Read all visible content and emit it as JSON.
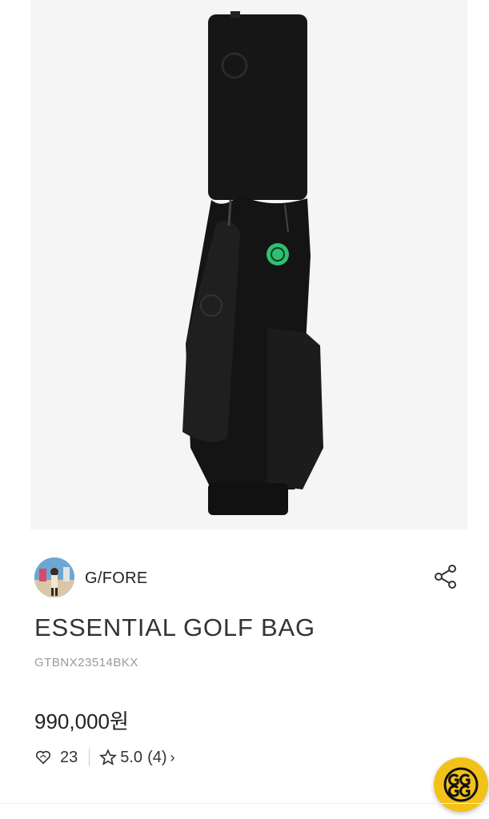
{
  "product": {
    "image_alt": "",
    "brand": "G/FORE",
    "title": "ESSENTIAL GOLF BAG",
    "sku": "GTBNX23514BKX",
    "price": "990,000원",
    "likes": "23",
    "rating": "5.0",
    "review_count": "(4)"
  },
  "icons": {
    "share": "share-icon",
    "like": "heart-icon",
    "rating": "star-icon",
    "more": "chevron-right-icon",
    "brand_badge": "gfore-logo-icon"
  },
  "colors": {
    "fab_background": "#f2c21a",
    "hero_background": "#f5f5f5",
    "tag_green": "#2fbf71"
  }
}
